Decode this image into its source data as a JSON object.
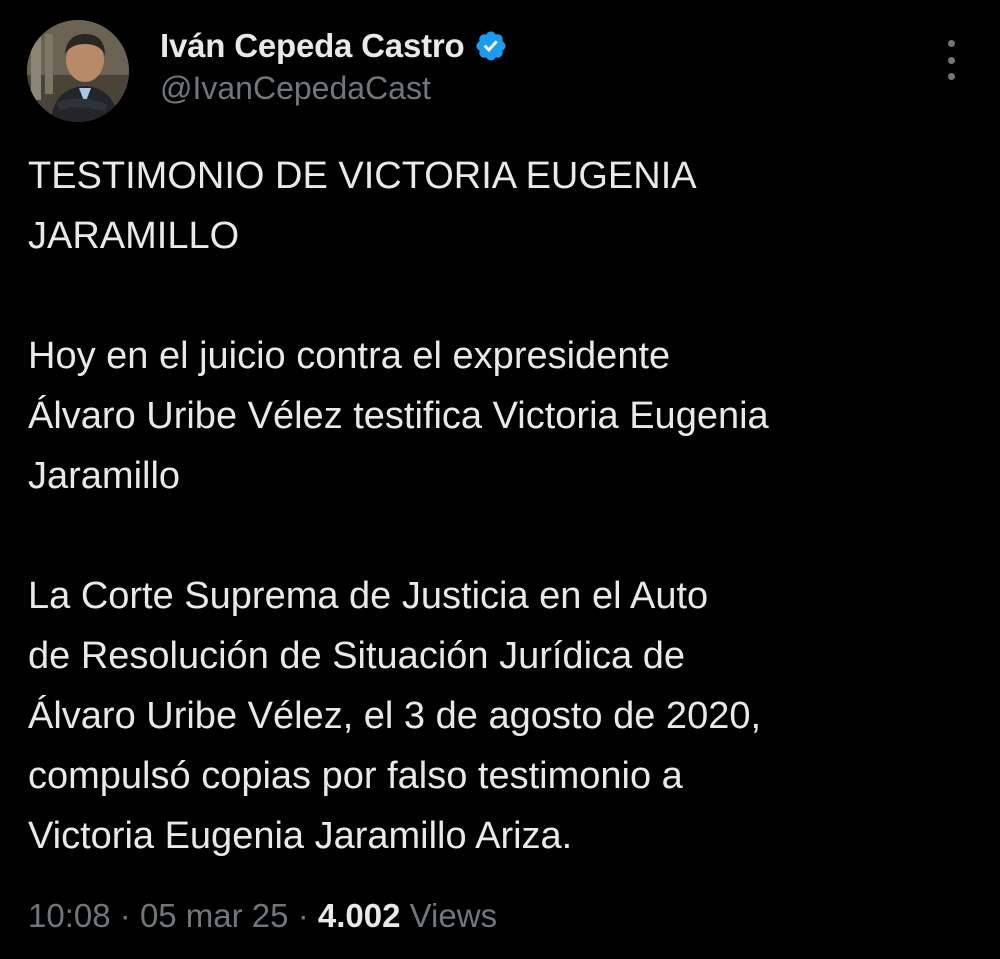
{
  "author": {
    "display_name": "Iván Cepeda Castro",
    "handle": "@IvanCepedaCast",
    "verified": true,
    "verified_color": "#1d9bf0",
    "avatar_icon": "profile-photo"
  },
  "more_icon": "more-vertical-icon",
  "tweet": {
    "paragraphs": [
      [
        "TESTIMONIO DE VICTORIA EUGENIA",
        "JARAMILLO"
      ],
      [
        "Hoy en el juicio contra el expresidente",
        "Álvaro Uribe Vélez testifica Victoria Eugenia",
        "Jaramillo"
      ],
      [
        "La Corte Suprema de Justicia en el Auto",
        "de Resolución de Situación Jurídica de",
        "Álvaro Uribe Vélez, el 3 de agosto de 2020,",
        "compulsó copias por falso testimonio a",
        "Victoria Eugenia Jaramillo Ariza."
      ]
    ]
  },
  "meta": {
    "time": "10:08",
    "separator": "·",
    "date": "05 mar 25",
    "views_count": "4.002",
    "views_label": "Views"
  },
  "colors": {
    "background": "#000000",
    "primary_text": "#e7e9ea",
    "secondary_text": "#71767b"
  }
}
